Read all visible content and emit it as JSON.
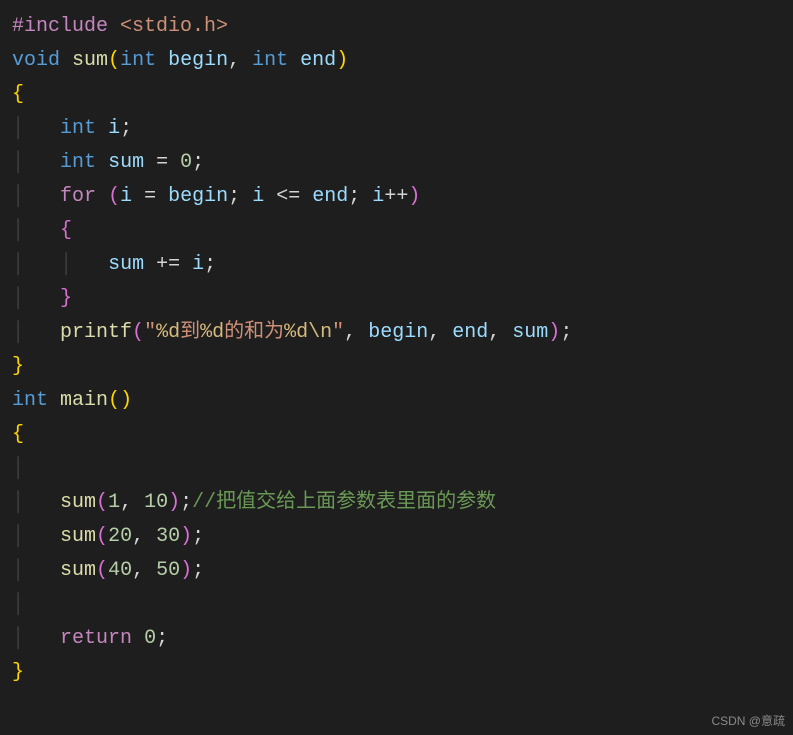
{
  "tokens": {
    "include": "#include",
    "stdio": "<stdio.h>",
    "void": "void",
    "int": "int",
    "for": "for",
    "return": "return",
    "sum_fn": "sum",
    "printf_fn": "printf",
    "main_fn": "main",
    "begin": "begin",
    "end": "end",
    "i": "i",
    "sum_var": "sum",
    "zero": "0",
    "one": "1",
    "ten": "10",
    "twenty": "20",
    "thirty": "30",
    "forty": "40",
    "fifty": "50",
    "str_open": "\"",
    "str_part1": "到",
    "str_part2": "的和为",
    "esc_d": "%d",
    "esc_n": "\\n",
    "str_close": "\"",
    "comment": "//把值交给上面参数表里面的参数"
  },
  "watermark": "CSDN @意疏"
}
